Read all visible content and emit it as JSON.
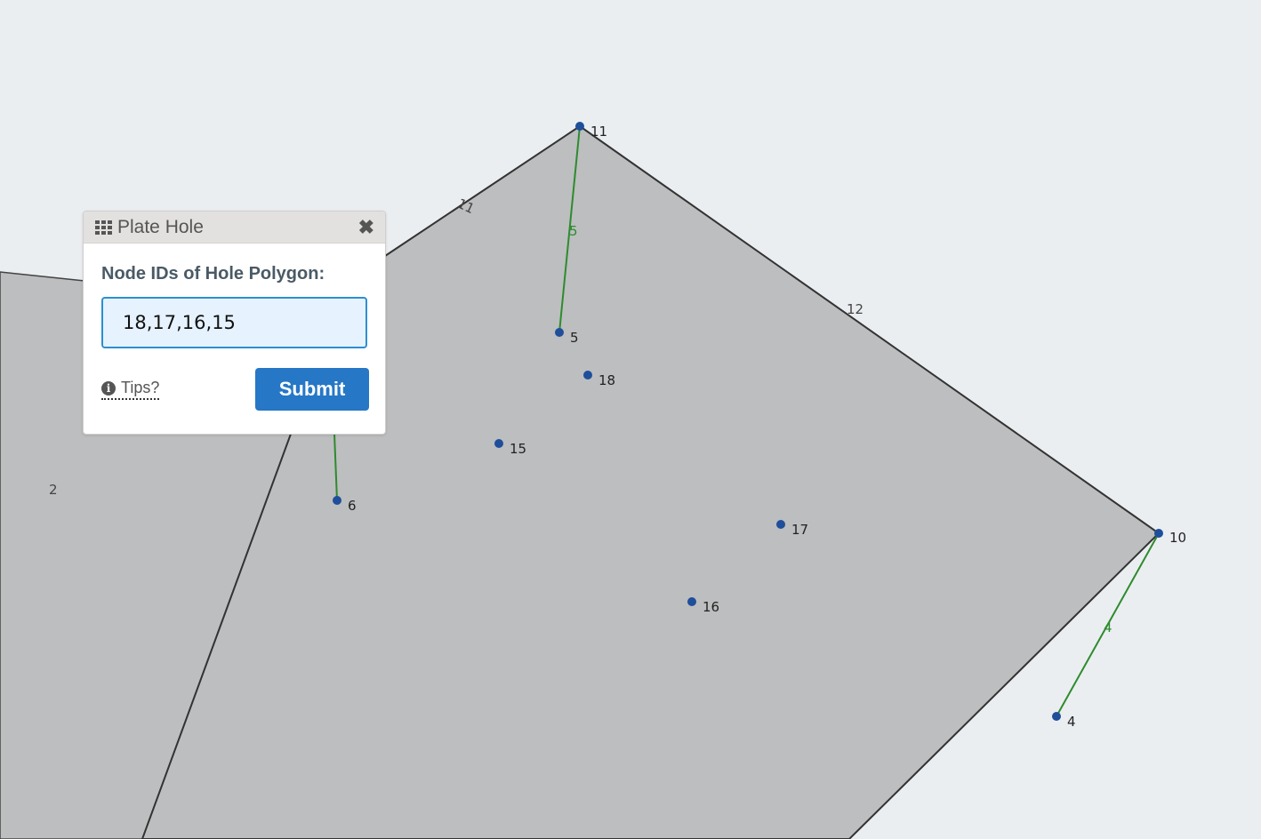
{
  "dialog": {
    "title": "Plate Hole",
    "field_label": "Node IDs of Hole Polygon:",
    "input_value": "18,17,16,15",
    "tips_label": "Tips?",
    "submit_label": "Submit"
  },
  "icons": {
    "title_icon": "grid-icon",
    "close_icon": "close-icon",
    "tips_icon": "info-icon"
  },
  "colors": {
    "background": "#ebeef1",
    "plate_fill": "#bcbebf",
    "node": "#1f4e9b",
    "member": "#2e8b2e",
    "submit": "#2677c6"
  },
  "nodes": [
    {
      "id": "11",
      "label": "11"
    },
    {
      "id": "5",
      "label": "5"
    },
    {
      "id": "18",
      "label": "18"
    },
    {
      "id": "15",
      "label": "15"
    },
    {
      "id": "6",
      "label": "6"
    },
    {
      "id": "17",
      "label": "17"
    },
    {
      "id": "16",
      "label": "16"
    },
    {
      "id": "10",
      "label": "10"
    },
    {
      "id": "4",
      "label": "4"
    }
  ],
  "element_labels": {
    "plate_2": "2",
    "edge_11": "11",
    "edge_12": "12",
    "member_5": "5",
    "member_4": "4"
  }
}
